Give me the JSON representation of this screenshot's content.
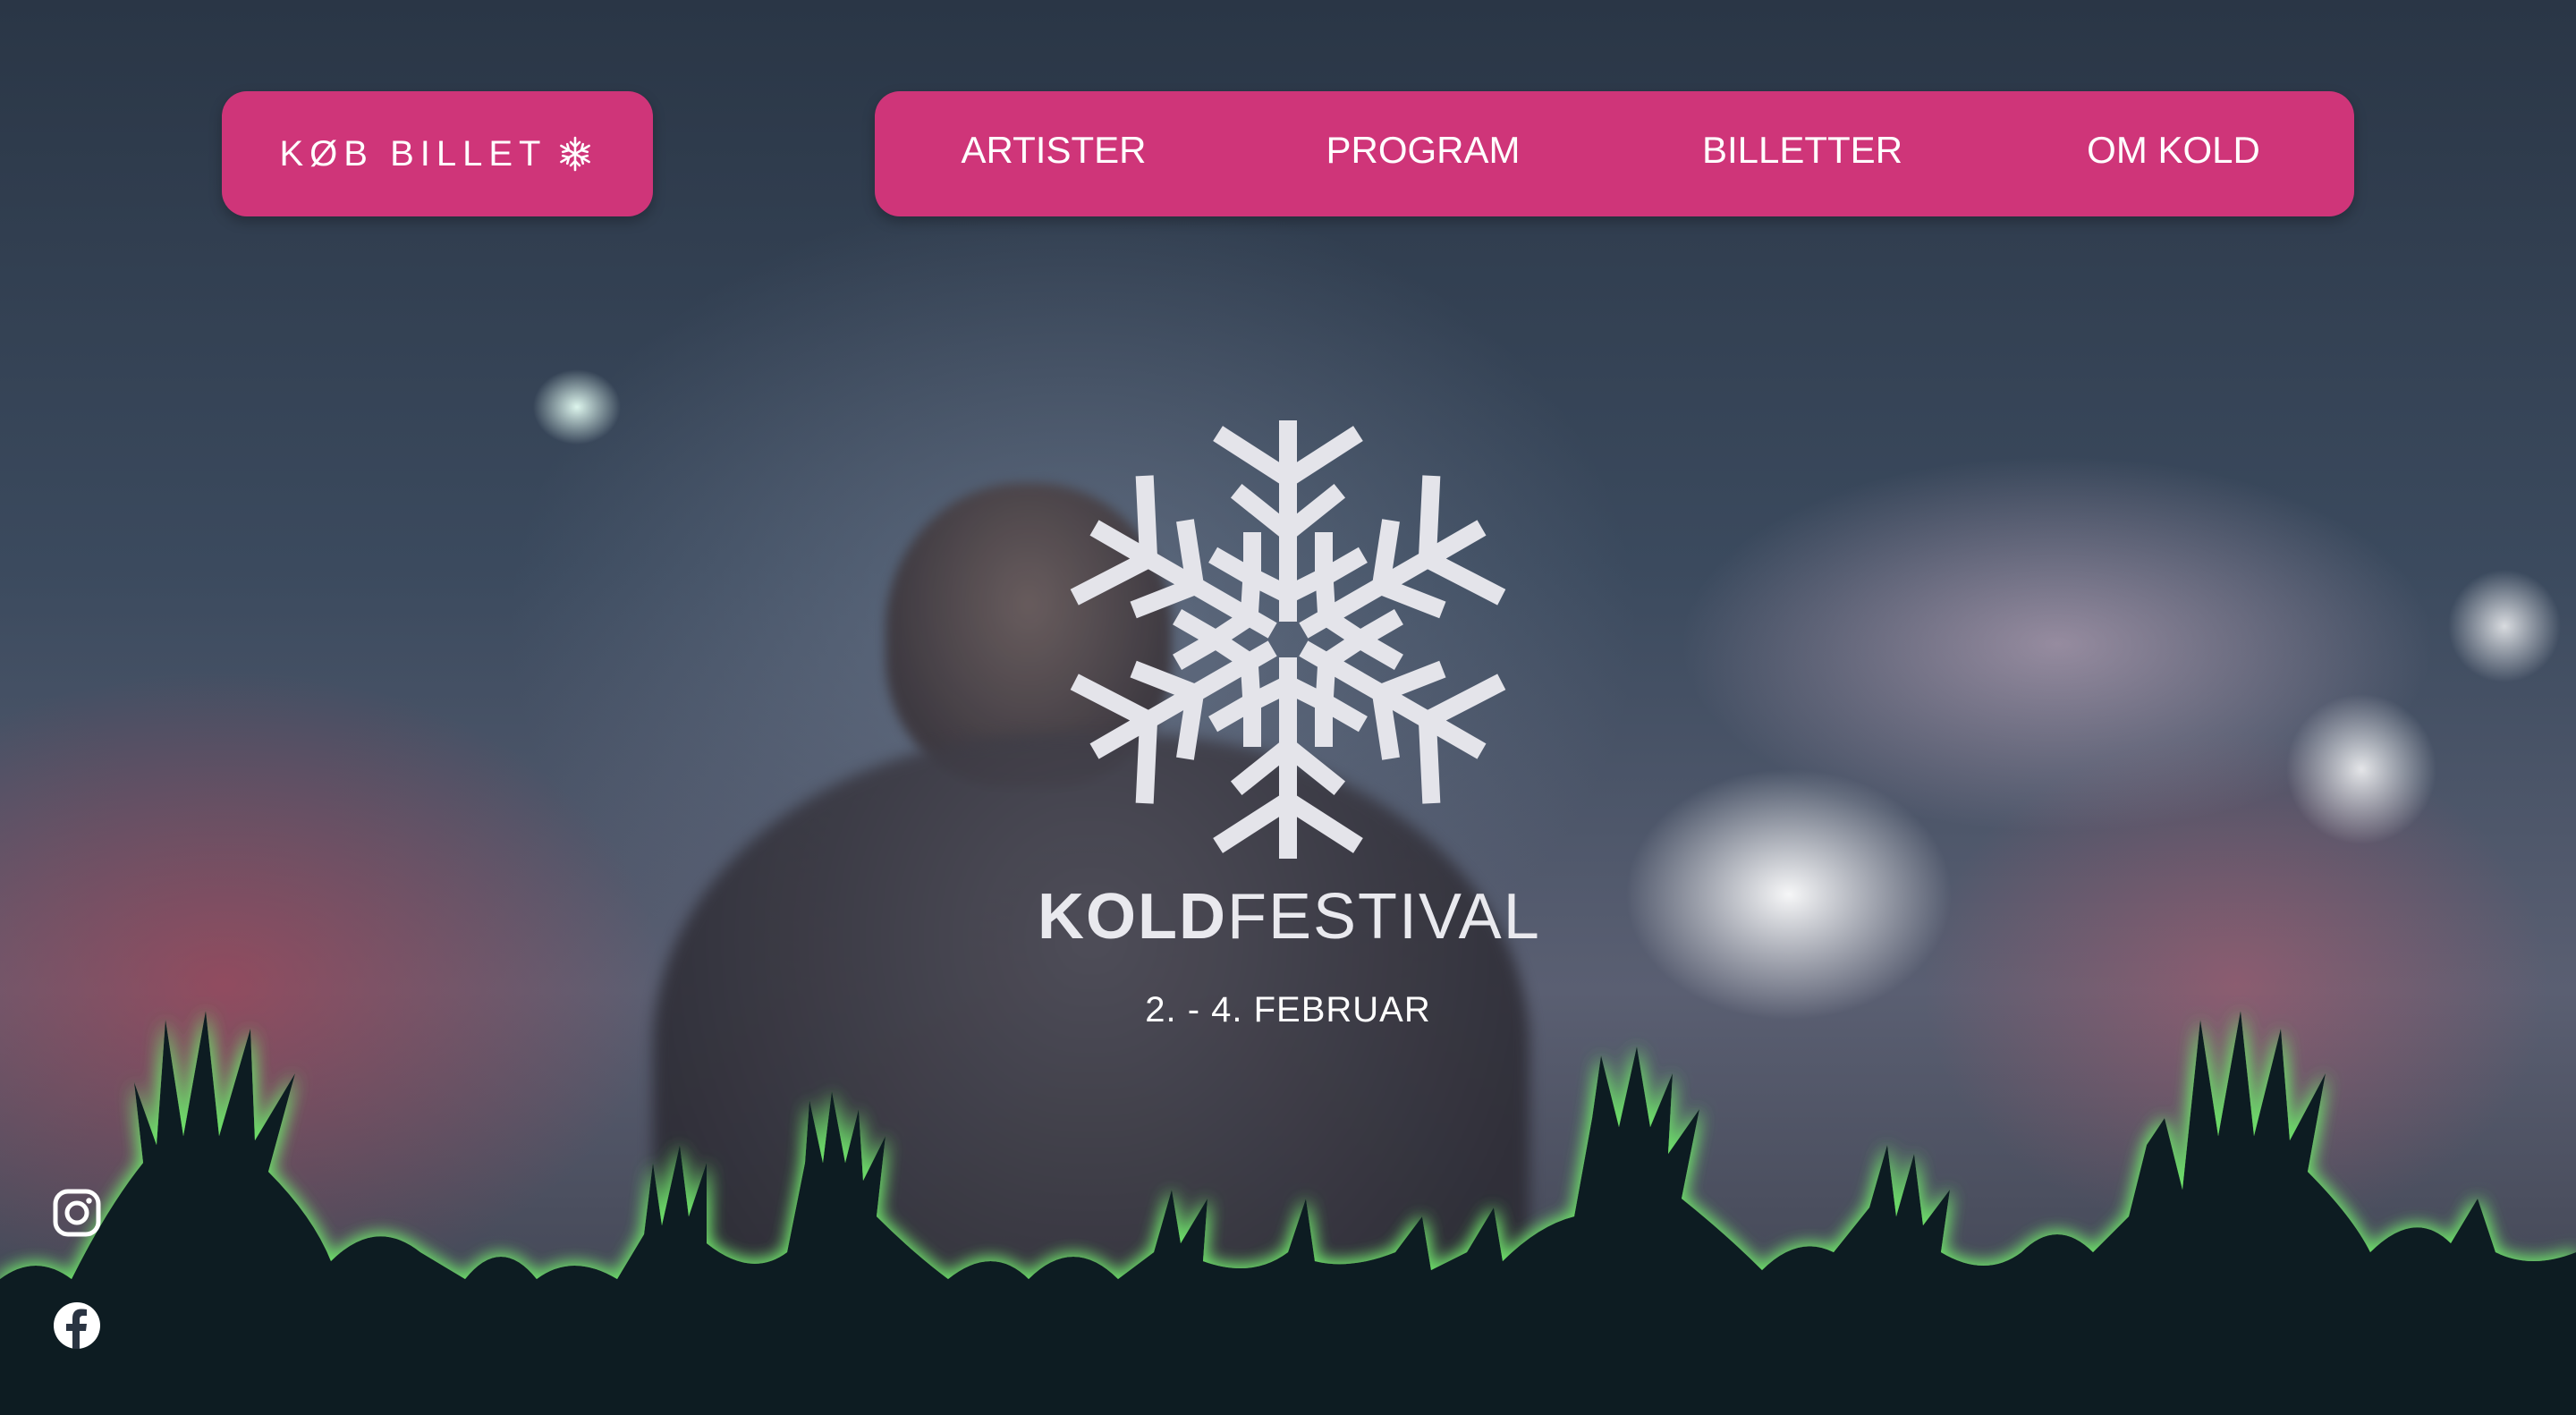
{
  "header": {
    "cta_label": "KØB BILLET",
    "cta_icon": "snowflake-icon",
    "nav": [
      {
        "label": "ARTISTER"
      },
      {
        "label": "PROGRAM"
      },
      {
        "label": "BILLETTER"
      },
      {
        "label": "OM KOLD"
      }
    ]
  },
  "hero": {
    "logo_icon": "snowflake-logo",
    "wordmark_bold": "KOLD",
    "wordmark_light": "FESTIVAL",
    "dates": "2. - 4. FEBRUAR"
  },
  "social": [
    {
      "icon": "instagram-icon"
    },
    {
      "icon": "facebook-icon"
    }
  ],
  "colors": {
    "accent": "#cf3579",
    "crowd_silhouette": "#0f1e24",
    "crowd_glow": "#6ee06a",
    "logo": "#e4e4ea"
  }
}
